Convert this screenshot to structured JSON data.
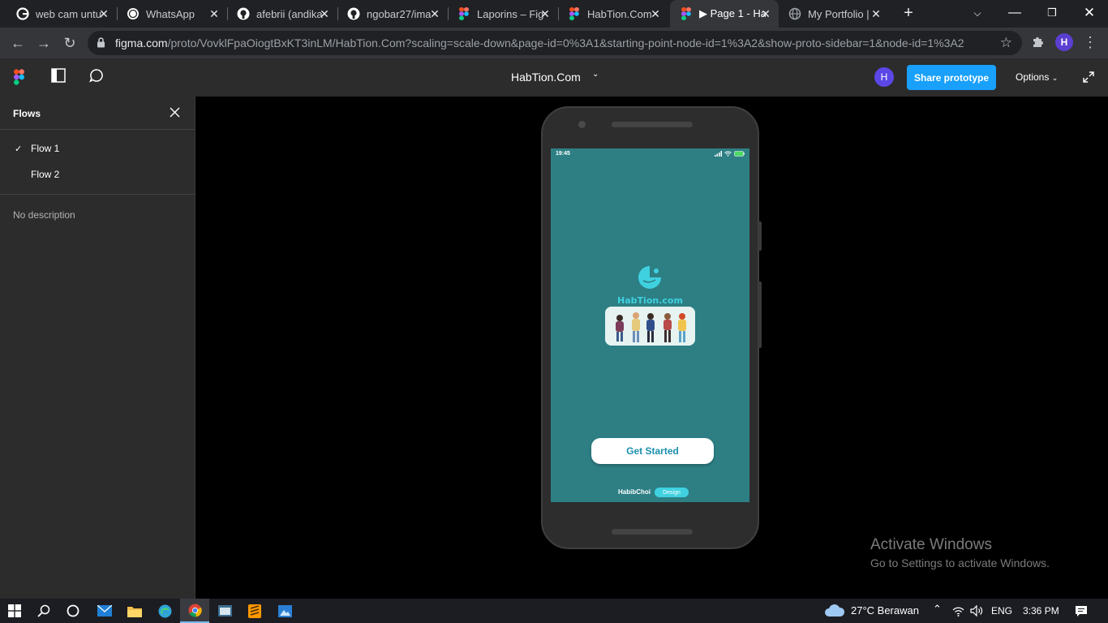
{
  "browser": {
    "tabs": [
      {
        "title": "web cam untuk",
        "icon": "google-icon",
        "active": false
      },
      {
        "title": "WhatsApp",
        "icon": "whatsapp-icon",
        "active": false
      },
      {
        "title": "afebrii (andika",
        "icon": "github-icon",
        "active": false
      },
      {
        "title": "ngobar27/ima",
        "icon": "github-icon",
        "active": false
      },
      {
        "title": "Laporins – Fig",
        "icon": "figma-icon",
        "active": false
      },
      {
        "title": "HabTion.Com",
        "icon": "figma-icon",
        "active": false
      },
      {
        "title": "▶ Page 1 - Ha",
        "icon": "figma-icon",
        "active": true
      },
      {
        "title": "My Portfolio | ",
        "icon": "globe-icon",
        "active": false
      }
    ],
    "url_host": "figma.com",
    "url_path": "/proto/VovklFpaOiogtBxKT3inLM/HabTion.Com?scaling=scale-down&page-id=0%3A1&starting-point-node-id=1%3A2&show-proto-sidebar=1&node-id=1%3A2",
    "profile_initial": "H"
  },
  "figma": {
    "file_title": "HabTion.Com",
    "avatar_initial": "H",
    "share_label": "Share prototype",
    "options_label": "Options"
  },
  "sidebar": {
    "title": "Flows",
    "flows": [
      {
        "label": "Flow 1",
        "selected": true
      },
      {
        "label": "Flow 2",
        "selected": false
      }
    ],
    "description": "No description"
  },
  "prototype": {
    "status_time": "19:45",
    "brand": "HabTion.com",
    "cta_label": "Get Started",
    "credit": "HabibChoi",
    "credit_badge": "Design",
    "bg_color": "#2d7f84",
    "accent_color": "#3fd1e0"
  },
  "watermark": {
    "line1": "Activate Windows",
    "line2": "Go to Settings to activate Windows."
  },
  "taskbar": {
    "weather": "27°C  Berawan",
    "language": "ENG",
    "time": "3:36 PM"
  }
}
